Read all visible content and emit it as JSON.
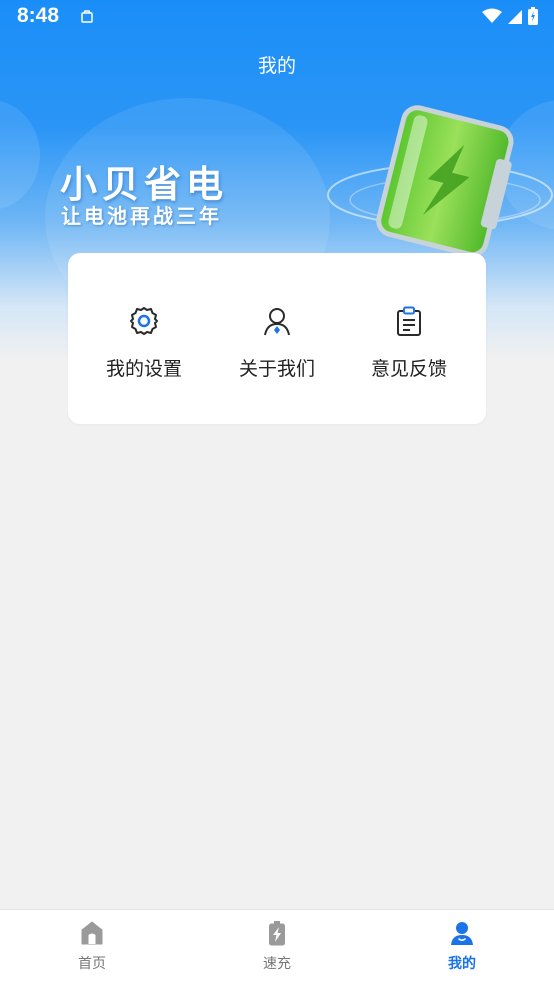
{
  "status_bar": {
    "time": "8:48"
  },
  "header": {
    "title": "我的"
  },
  "banner": {
    "title": "小贝省电",
    "subtitle": "让电池再战三年"
  },
  "menu": [
    {
      "label": "我的设置",
      "icon": "gear-icon"
    },
    {
      "label": "关于我们",
      "icon": "user-icon"
    },
    {
      "label": "意见反馈",
      "icon": "clipboard-icon"
    }
  ],
  "bottom_nav": [
    {
      "label": "首页",
      "icon": "home-icon",
      "active": false
    },
    {
      "label": "速充",
      "icon": "battery-charge-icon",
      "active": false
    },
    {
      "label": "我的",
      "icon": "person-icon",
      "active": true
    }
  ],
  "colors": {
    "accent": "#1a73e8",
    "header_blue": "#1a8ef8",
    "background": "#f1f1f1"
  }
}
